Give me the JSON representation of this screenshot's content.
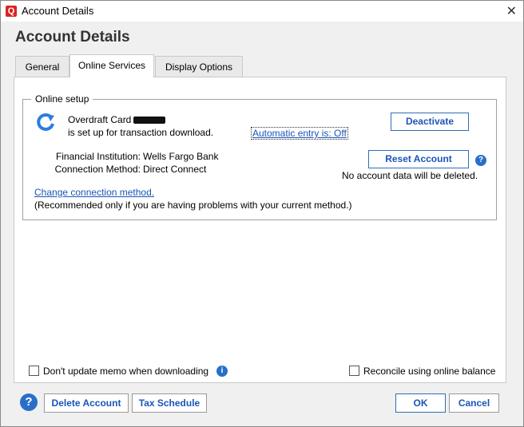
{
  "titlebar": {
    "app_icon": "Q",
    "title": "Account Details",
    "close": "✕"
  },
  "heading": "Account Details",
  "tabs": [
    {
      "label": "General"
    },
    {
      "label": "Online Services"
    },
    {
      "label": "Display Options"
    }
  ],
  "online_setup": {
    "group_label": "Online setup",
    "account_name": "Overdraft Card",
    "status": "is set up for transaction download.",
    "automatic_entry": "Automatic entry is: Off",
    "deactivate": "Deactivate",
    "institution_label": "Financial Institution:",
    "institution_value": "Wells Fargo Bank",
    "connection_label": "Connection Method:",
    "connection_value": "Direct Connect",
    "reset_button": "Reset Account",
    "reset_note": "No account data will be deleted.",
    "change_link": "Change connection method.",
    "change_note": "(Recommended only if you are having problems with your current method.)"
  },
  "options": {
    "memo_label": "Don't update memo when downloading",
    "memo_checked": false,
    "reconcile_label": "Reconcile using online balance",
    "reconcile_checked": false
  },
  "footer": {
    "help": "?",
    "delete": "Delete Account",
    "tax": "Tax Schedule",
    "ok": "OK",
    "cancel": "Cancel"
  },
  "colors": {
    "accent": "#2a6fc7",
    "link": "#1a55b8",
    "brand": "#d22222"
  }
}
